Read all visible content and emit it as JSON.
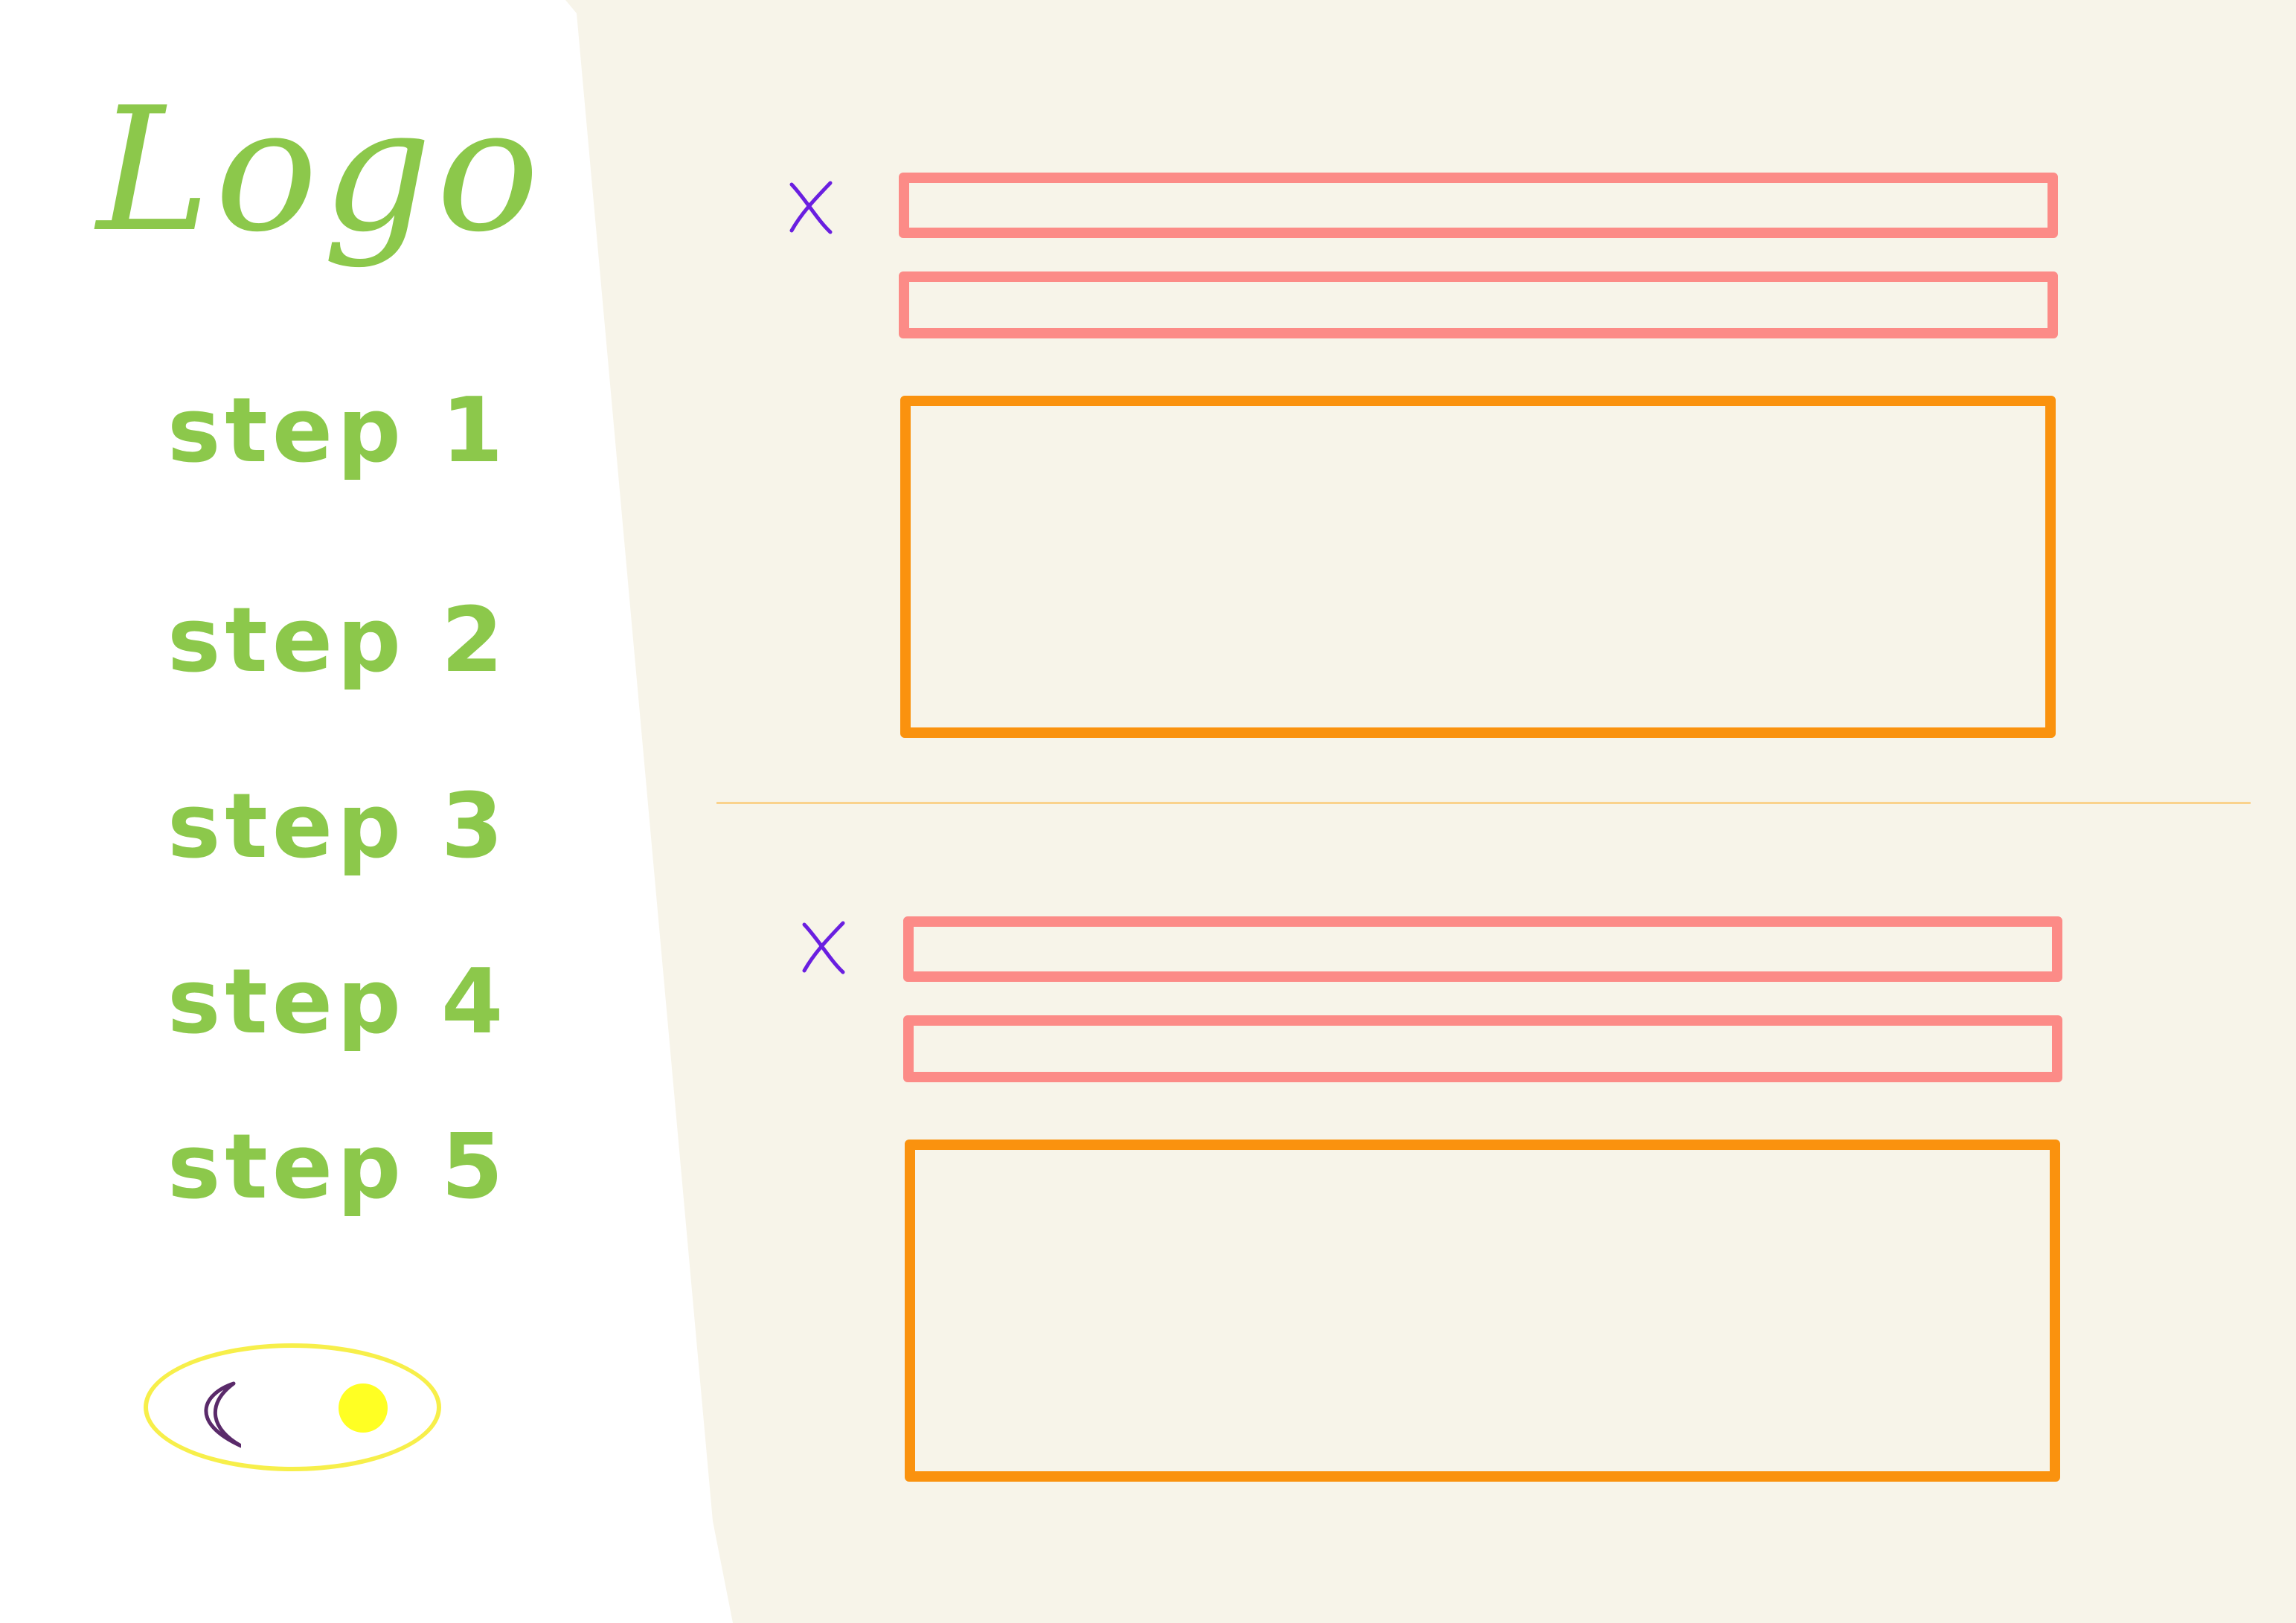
{
  "sidebar": {
    "logo_text": "Logo",
    "steps": [
      {
        "label": "step 1"
      },
      {
        "label": "step 2"
      },
      {
        "label": "step 3"
      },
      {
        "label": "step 4"
      },
      {
        "label": "step 5"
      }
    ],
    "theme_toggle": {
      "left_icon": "moon-icon",
      "right_icon": "sun-icon"
    }
  },
  "main": {
    "sections": [
      {
        "close_icon": "close-icon",
        "fields": [
          "",
          ""
        ],
        "panel": ""
      },
      {
        "close_icon": "close-icon",
        "fields": [
          "",
          ""
        ],
        "panel": ""
      }
    ]
  },
  "colors": {
    "sidebar_bg": "#ffffff",
    "main_bg": "#f7f4e9",
    "text_green": "#8cc84b",
    "field_border": "#fc8b87",
    "panel_border": "#fa920e",
    "divider": "#fad28c",
    "close_icon": "#6a1fe0",
    "toggle_border": "#f7ef4a",
    "sun": "#ffff23",
    "moon": "#5a2a6a"
  }
}
